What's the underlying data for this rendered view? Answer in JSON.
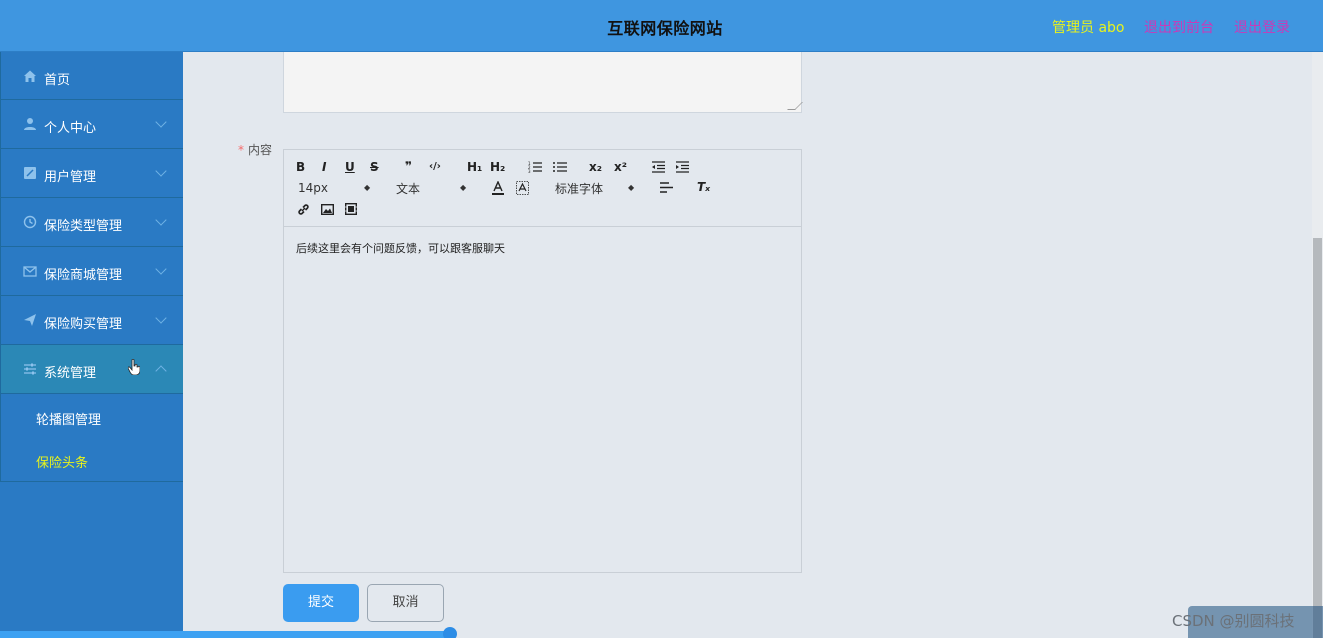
{
  "header": {
    "title": "互联网保险网站",
    "admin_label": "管理员 abo",
    "link_front": "退出到前台",
    "link_logout": "退出登录"
  },
  "sidebar": {
    "items": [
      {
        "label": "首页",
        "icon": "home-icon"
      },
      {
        "label": "个人中心",
        "icon": "user-icon"
      },
      {
        "label": "用户管理",
        "icon": "edit-icon"
      },
      {
        "label": "保险类型管理",
        "icon": "clock-icon"
      },
      {
        "label": "保险商城管理",
        "icon": "mail-icon"
      },
      {
        "label": "保险购买管理",
        "icon": "send-icon"
      },
      {
        "label": "系统管理",
        "icon": "settings-icon"
      }
    ],
    "submenu": [
      {
        "label": "轮播图管理"
      },
      {
        "label": "保险头条"
      }
    ]
  },
  "form": {
    "content_label": "内容",
    "required_mark": "*",
    "content_text": "后续这里会有个问题反馈，可以跟客服聊天"
  },
  "editor": {
    "font_size": "14px",
    "paragraph": "文本",
    "font_family": "标准字体",
    "btn_bold": "B",
    "btn_italic": "I",
    "btn_underline": "U",
    "btn_strike": "S",
    "btn_quote": "❞",
    "btn_code": "‹/›",
    "btn_h1": "H₁",
    "btn_h2": "H₂",
    "btn_sub": "x₂",
    "btn_sup": "x²",
    "btn_clear": "Tₓ"
  },
  "buttons": {
    "submit": "提交",
    "cancel": "取消"
  },
  "watermark": "CSDN @别圆科技",
  "colors": {
    "header_bg": "#3f96e0",
    "sidebar_bg": "#2a7ac4",
    "accent_yellow": "#e8f31c",
    "accent_magenta": "#c93ab8",
    "primary_button": "#3a9cf0"
  }
}
